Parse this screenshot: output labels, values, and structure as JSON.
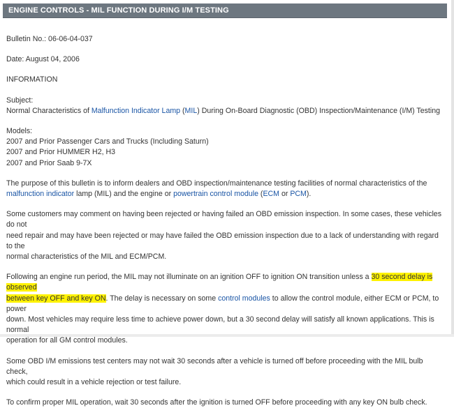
{
  "header": {
    "title": "ENGINE CONTROLS - MIL FUNCTION DURING I/M TESTING"
  },
  "bulletin": {
    "number": "Bulletin No.: 06-06-04-037",
    "date": "Date: August 04, 2006",
    "type": "INFORMATION"
  },
  "subject": {
    "label": "Subject:",
    "pre": "Normal Characteristics of ",
    "link_mil_lamp": "Malfunction Indicator Lamp",
    "mid1": " (",
    "link_mil": "MIL",
    "post": ") During On-Board Diagnostic (OBD) Inspection/Maintenance (I/M) Testing"
  },
  "models": {
    "label": "Models:",
    "items": [
      "2007 and Prior Passenger Cars and Trucks (Including Saturn)",
      "2007 and Prior HUMMER H2, H3",
      "2007 and Prior Saab 9-7X"
    ]
  },
  "purpose": {
    "line1": "The purpose of this bulletin is to inform dealers and OBD inspection/maintenance testing facilities of normal characteristics of the",
    "link_mil": "malfunction indicator",
    "t1": " lamp (MIL) and the engine or ",
    "link_pcm": "powertrain control module",
    "t2": " (",
    "link_ecm": "ECM",
    "t3": " or ",
    "link_pcm_abbr": "PCM",
    "t4": ")."
  },
  "customers": {
    "line1": "Some customers may comment on having been rejected or having failed an OBD emission inspection. In some cases, these vehicles do not",
    "line2": "need repair and may have been rejected or may have failed the OBD emission inspection due to a lack of understanding with regard to the",
    "line3": "normal characteristics of the MIL and ECM/PCM."
  },
  "following": {
    "line1_pre": "Following an engine run period, the MIL may not illuminate on an ignition OFF to ignition ON transition unless a ",
    "line1_hl": "30 second delay is observed",
    "line2_hl": "between key OFF and key ON",
    "line2_mid": ". The delay is necessary on some ",
    "link_cm": "control modules",
    "line2_post": " to allow the control module, either ECM or PCM, to power",
    "line3": "down. Most vehicles may require less time to achieve power down, but a 30 second delay will satisfy all known applications. This is normal",
    "line4": "operation for all GM control modules."
  },
  "centers": {
    "line1": "Some OBD I/M emissions test centers may not wait 30 seconds after a vehicle is turned off before proceeding with the MIL bulb check,",
    "line2": "which could result in a vehicle rejection or test failure."
  },
  "confirm": {
    "line1": "To confirm proper MIL operation, wait 30 seconds after the ignition is turned OFF before proceeding with any key ON bulb check."
  }
}
